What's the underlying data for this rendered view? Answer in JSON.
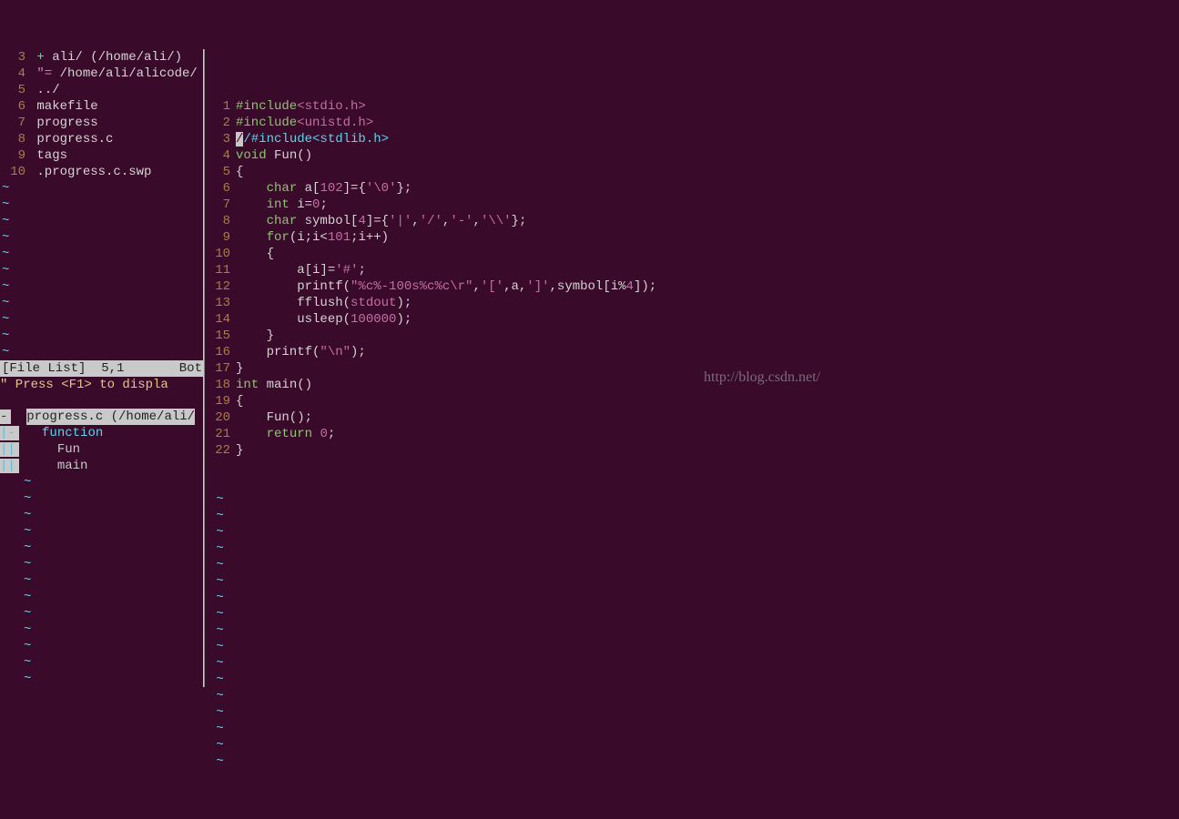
{
  "filelist": {
    "lines": [
      {
        "n": "3",
        "pre": "+ ",
        "txt": "ali/ (/home/ali/)"
      },
      {
        "n": "4",
        "pre": "\"= ",
        "txt": "/home/ali/alicode/"
      },
      {
        "n": "5",
        "txt": "../"
      },
      {
        "n": "6",
        "txt": "makefile"
      },
      {
        "n": "7",
        "txt": "progress"
      },
      {
        "n": "8",
        "txt": "progress.c"
      },
      {
        "n": "9",
        "txt": "tags"
      },
      {
        "n": "10",
        "txt": ".progress.c.swp"
      }
    ],
    "status": {
      "name": "[File List]",
      "pos": "5,1",
      "where": "Bot"
    },
    "msg": "\" Press <F1> to displa"
  },
  "taglist": {
    "header": "progress.c (/home/ali/",
    "rows": [
      {
        "mark": "|-",
        "indent": "   ",
        "txt": "function",
        "cls": "tagname"
      },
      {
        "mark": "||",
        "indent": "     ",
        "txt": "Fun",
        "cls": ""
      },
      {
        "mark": "||",
        "indent": "     ",
        "txt": "main",
        "cls": ""
      }
    ]
  },
  "code": [
    {
      "n": "1",
      "html": "<span class='inc'>#include</span><span class='hdr'>&lt;stdio.h&gt;</span>"
    },
    {
      "n": "2",
      "html": "<span class='inc'>#include</span><span class='hdr'>&lt;unistd.h&gt;</span>"
    },
    {
      "n": "3",
      "html": "<span class='cursor'>/</span><span class='cmt'>/#include&lt;stdlib.h&gt;</span>"
    },
    {
      "n": "4",
      "html": "<span class='kw'>void</span> Fun()"
    },
    {
      "n": "5",
      "html": "{"
    },
    {
      "n": "6",
      "html": "    <span class='kw'>char</span> a[<span class='num'>102</span>]={<span class='str'>'\\0'</span>};"
    },
    {
      "n": "7",
      "html": "    <span class='kw'>int</span> i=<span class='num'>0</span>;"
    },
    {
      "n": "8",
      "html": "    <span class='kw'>char</span> symbol[<span class='num'>4</span>]={<span class='str'>'|'</span>,<span class='str'>'/'</span>,<span class='str'>'-'</span>,<span class='str'>'\\\\'</span>};"
    },
    {
      "n": "9",
      "html": "    <span class='kw'>for</span>(i;i&lt;<span class='num'>101</span>;i++)"
    },
    {
      "n": "10",
      "html": "    {"
    },
    {
      "n": "11",
      "html": "        a[i]=<span class='str'>'#'</span>;"
    },
    {
      "n": "12",
      "html": "        printf(<span class='str'>\"%c%-100s%c%c\\r\"</span>,<span class='str'>'['</span>,a,<span class='str'>']'</span>,symbol[i%<span class='num'>4</span>]);"
    },
    {
      "n": "13",
      "html": "        fflush(<span class='hdr'>stdout</span>);"
    },
    {
      "n": "14",
      "html": "        usleep(<span class='num'>100000</span>);"
    },
    {
      "n": "15",
      "html": "    }"
    },
    {
      "n": "16",
      "html": "    printf(<span class='str'>\"\\n\"</span>);"
    },
    {
      "n": "17",
      "html": "}"
    },
    {
      "n": "18",
      "html": "<span class='kw'>int</span> main()"
    },
    {
      "n": "19",
      "html": "{"
    },
    {
      "n": "20",
      "html": "    Fun();"
    },
    {
      "n": "21",
      "html": "    <span class='kw'>return</span> <span class='num'>0</span>;"
    },
    {
      "n": "22",
      "html": "}"
    }
  ],
  "watermark": "http://blog.csdn.net/"
}
